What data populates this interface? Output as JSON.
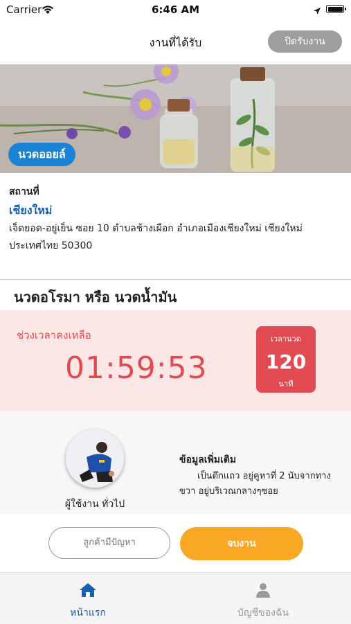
{
  "status_bar": {
    "carrier": "Carrier",
    "time": "6:46 AM"
  },
  "header": {
    "title": "งานที่ได้รับ",
    "close_button": "ปิดรับงาน"
  },
  "hero": {
    "badge": "นวดออยล์"
  },
  "location": {
    "label": "สถานที่",
    "city": "เชียงใหม่",
    "address": "เจ็ดยอด-อยู่เย็น ซอย 10 ตำบลช้างเผือก อำเภอเมืองเชียงใหม่ เชียงใหม่ ประเทศไทย 50300"
  },
  "service": {
    "name": "นวดอโรมา หรือ นวดน้ำมัน"
  },
  "timer": {
    "remaining_label": "ช่วงเวลาคงเหลือ",
    "countdown": "01:59:53",
    "duration_label": "เวลานวด",
    "duration_value": "120",
    "duration_unit": "นาที"
  },
  "customer": {
    "name": "ผู้ใช้งาน ทั่วไป",
    "more_info_title": "ข้อมูลเพิ่มเติม",
    "more_info_text": "เป็นตึกแถว อยู่คูหาที่ 2 นับจากทางขวา อยู่บริเวณกลางๆซอย"
  },
  "actions": {
    "problem_button": "ลูกค้ามีปัญหา",
    "finish_button": "จบงาน"
  },
  "tabbar": {
    "items": [
      {
        "label": "หน้าแรก",
        "icon": "home-icon",
        "active": true
      },
      {
        "label": "บัญชีของฉัน",
        "icon": "user-icon",
        "active": false
      }
    ]
  },
  "colors": {
    "accent_blue": "#1c83d4",
    "link_blue": "#1a5fb0",
    "timer_red": "#e04b4f",
    "timer_bg": "#fde6e6",
    "finish_orange": "#f9a826"
  }
}
